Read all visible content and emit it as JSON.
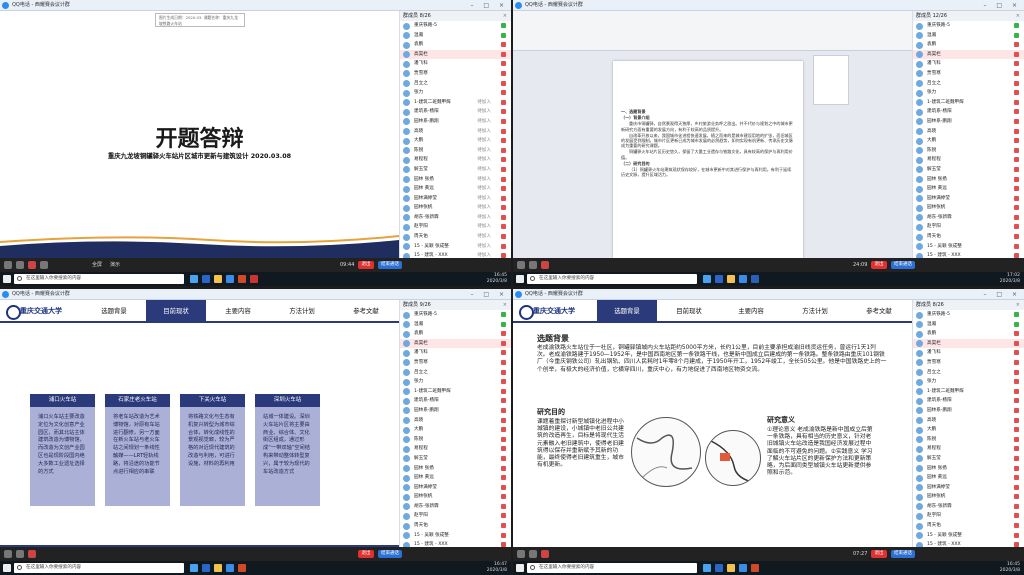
{
  "app": {
    "title": "QQ电话 - 西耀赛会议计群"
  },
  "quad1": {
    "doc_top": "图片生成日期：2020.03.  课题名称：重庆九龙坡铁路火车站",
    "slide_title": "开题答辩",
    "slide_subtitle": "重庆九龙坡铜罐驿火车站片区城市更新与建筑设计   2020.03.08",
    "plist_header": "群成员 8/26",
    "members": [
      {
        "name": "重庆铁路-5",
        "status": ""
      },
      {
        "name": "温瀚",
        "status": ""
      },
      {
        "name": "袁鹏",
        "status": ""
      },
      {
        "name": "高昊栏",
        "status": ""
      },
      {
        "name": "潘飞科",
        "status": ""
      },
      {
        "name": "贾雪寒",
        "status": ""
      },
      {
        "name": "吕立之",
        "status": ""
      },
      {
        "name": "张力",
        "status": ""
      },
      {
        "name": "1-建筑二班魏甲辉",
        "status": "待加入"
      },
      {
        "name": "建筑系-杨阳",
        "status": "待加入"
      },
      {
        "name": "园林系-鹏翔",
        "status": "待加入"
      },
      {
        "name": "高晓",
        "status": "待加入"
      },
      {
        "name": "大鹏",
        "status": "待加入"
      },
      {
        "name": "陈锐",
        "status": "待加入"
      },
      {
        "name": "易程程",
        "status": "待加入"
      },
      {
        "name": "解玉莹",
        "status": "待加入"
      },
      {
        "name": "园林 张扬",
        "status": "待加入"
      },
      {
        "name": "园林 黄远",
        "status": "待加入"
      },
      {
        "name": "园林满婷莹",
        "status": "待加入"
      },
      {
        "name": "园林张帆",
        "status": "待加入"
      },
      {
        "name": "胡东-张新霖",
        "status": "待加入"
      },
      {
        "name": "赵宇阳",
        "status": "待加入"
      },
      {
        "name": "周天佑",
        "status": "待加入"
      },
      {
        "name": "15 - 吴颖 张成整",
        "status": "待加入"
      },
      {
        "name": "15 - 建筑 - XXX",
        "status": "待加入"
      }
    ],
    "ctrl": {
      "timer": "09:44",
      "exit": "退出",
      "end": "结束通话",
      "fullscreen": "全屏",
      "screen": "演示"
    },
    "taskbar": {
      "search": "在这里输入你要搜索的内容",
      "time": "16:45",
      "date": "2020/3/8"
    }
  },
  "quad2": {
    "plist_header": "群成员 12/26",
    "members": [
      "重庆铁路-5",
      "温瀚",
      "袁鹏",
      "高昊栏",
      "潘飞科",
      "贾雪寒",
      "吕立之",
      "张力",
      "1-建筑二班魏甲辉",
      "建筑系-杨阳",
      "园林系-鹏翔",
      "高晓",
      "大鹏",
      "陈锐",
      "易程程",
      "解玉莹",
      "园林 张扬",
      "园林 黄远",
      "园林满婷莹",
      "园林张帆",
      "胡东-张新霖",
      "赵宇阳",
      "周天佑",
      "15 - 吴颖 张成整",
      "15 - 建筑 - XXX"
    ],
    "doc": {
      "h1": "一、选题背景",
      "h2": "（一）背景介绍",
      "p1": "重庆市铜罐驿，自然景观得天独厚，乡村旅游业务呼之欲出。并不代价与规划之中的城市更新研究方面有重要的发展方向，有利于较高的品质提升。",
      "p2": "自改革开放以来，我国城市化进程快速发展，随之而来的是城市建设用地的扩张，而旧城区的发展受到限制。城市片区更新已成为城市发展的必然趋势，如何实现有机更新、传承历史文脉成为重要的研究课题。",
      "p3": "铜罐驿火车站片区历史悠久，保留了大量工业遗存与铁路文化，具有较高的保护与再利用价值。",
      "h3": "（二）研究目的",
      "p4": "（1）铜罐驿火车站建筑现状保存较好，在城市更新中对其进行保护与再利用，有利于延续历史文脉，提升区域活力。"
    },
    "ctrl": {
      "timer": "24:09",
      "exit": "退出",
      "end": "结束通话"
    },
    "taskbar": {
      "search": "在这里输入你要搜索的内容",
      "time": "17:02",
      "date": "2020/3/8"
    }
  },
  "quad3": {
    "plist_header": "群成员 9/26",
    "logo": "重庆交通大学",
    "nav": [
      "选题背景",
      "目前现状",
      "主要内容",
      "方法计划",
      "参考文献"
    ],
    "cards": [
      {
        "title": "浦口火车站",
        "body": "浦口火车站主要改造定位为文化创意产业园区，而其北站主体建筑改造为博物馆，而改造为文创产业园区也是现阶段国内绝大多数工业遗址选择的方式"
      },
      {
        "title": "石家庄老火车站",
        "body": "将老车站改造为艺术博物馆，对原有车站进行翻修，另一方面在新火车站与老火车站之间规划一条线性触媒——LRT轻轨线路，将沿途的功能节点进行相应的串联"
      },
      {
        "title": "下关火车站",
        "body": "将铁路文化与生态有机复兴转型为城市综合体，转化成线性的景观视觉廊，较为严格的对近现代建筑的改造与利用，可进行设施，材料的再利用"
      },
      {
        "title": "深圳火车站",
        "body": "站城一体建设。深圳火车站片区将主要由商业、综合体、文化街区组成，通过形成“一带双轴”空间结构来带动整体转型复兴，属于较为现代的车站改造方式"
      }
    ],
    "ctrl": {
      "exit": "退出",
      "end": "结束通话"
    },
    "taskbar": {
      "search": "在这里输入你要搜索的内容",
      "time": "16:47",
      "date": "2020/3/8"
    }
  },
  "quad4": {
    "plist_header": "群成员 8/26",
    "logo": "重庆交通大学",
    "nav": [
      "选题背景",
      "目前现状",
      "主要内容",
      "方法计划",
      "参考文献"
    ],
    "bg_title": "选题背景",
    "bg_text": "老成渝铁路火车站位于一社区，铜罐驿镇城内火车站距约5000平方米，长约1公里，目前主要承担成渝旧线货运任务，曾运行1天1列次。老成渝铁路建于1950—1952年，是中国西南地区第一条铁路干线，也是新中国成立后建成的第一条铁路。整条铁路由重庆101钢铁厂（今重庆钢铁公司）轧出钢轨、四川人民耗时1年零8个月建成，于1950年开工，1952年竣工，全长505公里。他是中国铁路史上的一个创举，有极大的经济价值，它横穿四川，重庆中心，有力地促进了西南地区物资交流。",
    "purpose_title": "研究目的",
    "purpose_text": "课题着重探讨新型城镇化进程中小城镇的建设，小城镇中老旧公共建筑的改造再生，目标是将现代生活元素融入老旧建筑中，使得老旧建筑得以保存并重新赋予其新的功能，最终使得老旧建筑重生，城市有机更新。",
    "meaning_title": "研究意义",
    "meaning_text": "①理论意义 老成渝铁路是新中国成立后第一条铁路，具有相当的历史意义，针对老旧城镇火车站改造是我国经济发展过程中面临的不可避免的问题。②实践意义 学习了解火车站片区的更新保护方法和更新策略，为后面同类型城镇火车站更新提供参照和示范。",
    "ctrl": {
      "timer": "07:27",
      "exit": "退出",
      "end": "结束通话"
    },
    "taskbar": {
      "search": "在这里输入你要搜索的内容",
      "time": "16:45",
      "date": "2020/3/8"
    }
  }
}
